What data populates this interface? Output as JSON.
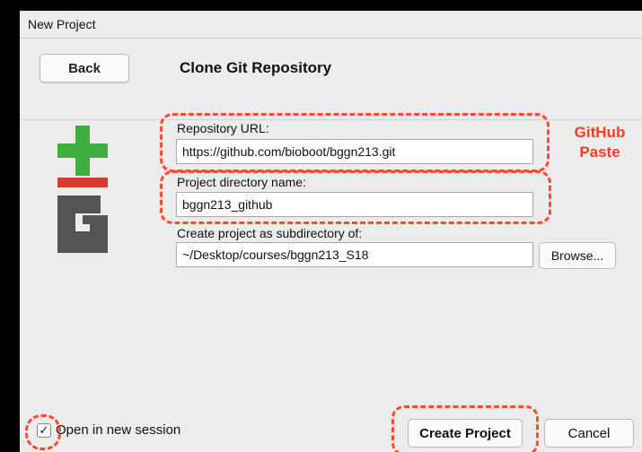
{
  "window": {
    "title": "New Project"
  },
  "header": {
    "back_label": "Back",
    "title": "Clone Git Repository"
  },
  "form": {
    "repo_url_label": "Repository URL:",
    "repo_url_value": "https://github.com/bioboot/bggn213.git",
    "dir_name_label": "Project directory name:",
    "dir_name_value": "bggn213_github",
    "subdir_label": "Create project as subdirectory of:",
    "subdir_value": "~/Desktop/courses/bggn213_S18",
    "browse_label": "Browse..."
  },
  "annotation": {
    "line1": "GitHub",
    "line2": "Paste",
    "color": "#ff3b1f"
  },
  "footer": {
    "open_new_session_label": "Open in new session",
    "open_new_session_checked": true,
    "check_mark": "✓",
    "create_label": "Create Project",
    "cancel_label": "Cancel"
  },
  "logo": {
    "icon": "git-logo-icon",
    "colors": {
      "plus": "#3fad3f",
      "bar": "#d63b2f",
      "letter": "#545454"
    }
  }
}
